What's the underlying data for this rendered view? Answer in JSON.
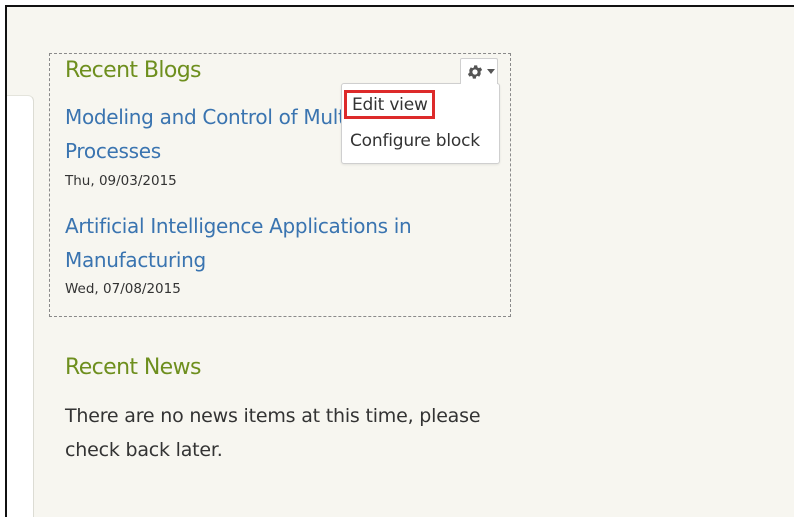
{
  "recent_blogs": {
    "title": "Recent Blogs",
    "posts": [
      {
        "title": "Modeling and Control of Multistage Processes",
        "date": "Thu, 09/03/2015"
      },
      {
        "title": "Artificial Intelligence Applications in Manufacturing",
        "date": "Wed, 07/08/2015"
      }
    ],
    "settings_icon": "gear-icon",
    "settings_menu": {
      "items": [
        {
          "label": "Edit view",
          "highlighted": true
        },
        {
          "label": "Configure block"
        }
      ]
    }
  },
  "recent_news": {
    "title": "Recent News",
    "message": "There are no news items at this time, please check back later."
  },
  "colors": {
    "heading": "#6e8f1e",
    "link": "#3a74b0",
    "highlight_border": "#dd2a2a",
    "background": "#f7f6f0"
  }
}
